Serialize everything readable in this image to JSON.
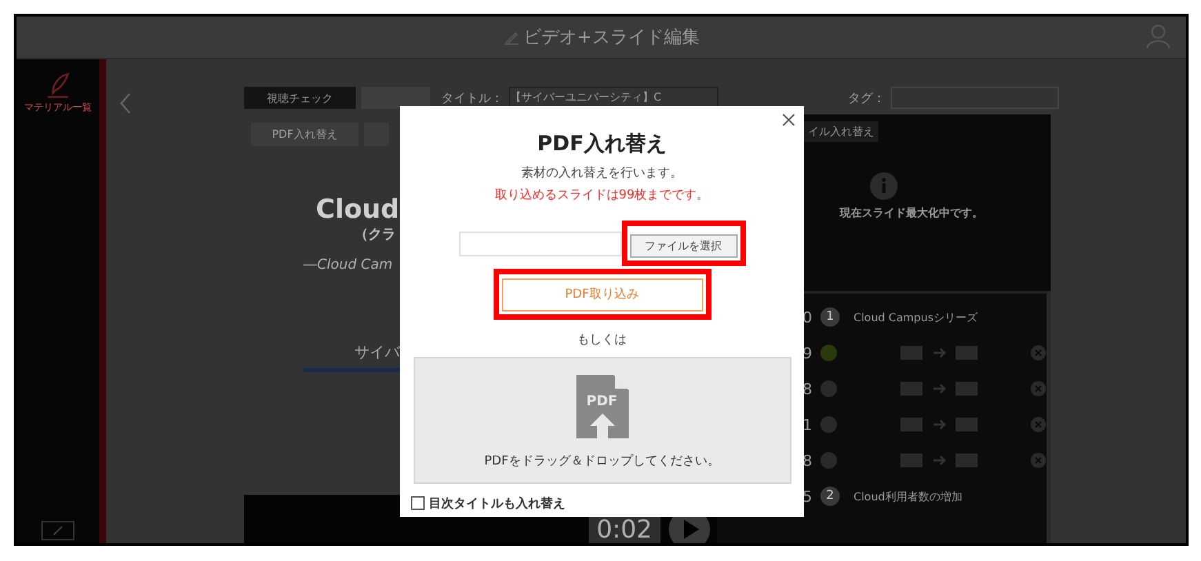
{
  "header": {
    "title": "ビデオ+スライド編集"
  },
  "sidebar": {
    "items": [
      {
        "label": "マテリアル一覧",
        "selected": true
      }
    ]
  },
  "toolbar": {
    "buttons": [
      "視聴チェック"
    ],
    "title_label": "タイトル：",
    "title_value": "【サイバーユニバーシティ】C",
    "tag_label": "タグ："
  },
  "tools": [
    "PDF入れ替え"
  ],
  "slide": {
    "title": "Cloud",
    "subtitle": "（クラ",
    "tagline": "―Cloud Cam",
    "caption": "サイバ"
  },
  "preview": {
    "button": "イル入れ替え",
    "message": "現在スライド最大化中です。"
  },
  "chapters": [
    {
      "kind": "chapter",
      "time": "0",
      "number": "1",
      "title": "Cloud Campusシリーズ"
    },
    {
      "kind": "slide",
      "time": "9",
      "selected": true
    },
    {
      "kind": "slide",
      "time": "8",
      "selected": false
    },
    {
      "kind": "slide",
      "time": "1",
      "selected": false
    },
    {
      "kind": "slide",
      "time": "8",
      "selected": false
    },
    {
      "kind": "chapter",
      "time": "5",
      "number": "2",
      "title": "Cloud利用者数の増加"
    }
  ],
  "player": {
    "time": "0:02"
  },
  "dialog": {
    "title": "PDF入れ替え",
    "description": "素材の入れ替えを行います。",
    "notice": "取り込めるスライドは99枚までです。",
    "file_button": {
      "label": "ファイルを選択",
      "highlighted": true
    },
    "import_button": {
      "label": "PDF取り込み",
      "highlighted": true
    },
    "separator": "もしくは",
    "drop_icon_label": "PDF",
    "drop_hint": "PDFをドラッグ＆ドロップしてください。",
    "checkbox": {
      "label": "目次タイトルも入れ替え",
      "checked": false
    }
  }
}
